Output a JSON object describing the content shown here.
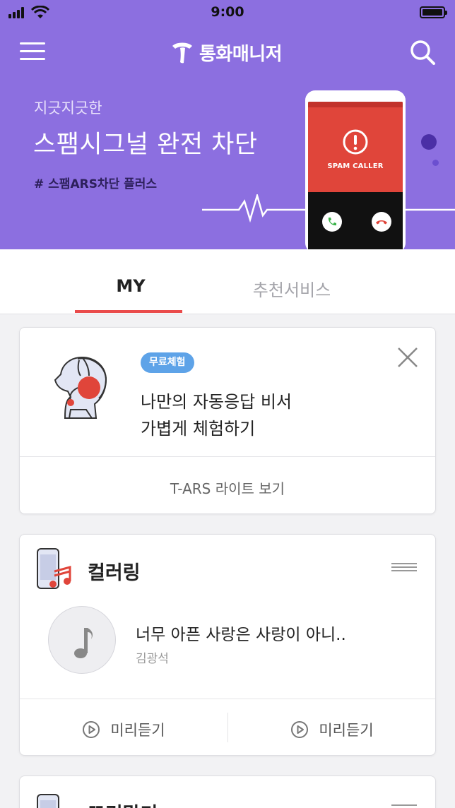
{
  "status_bar": {
    "time": "9:00"
  },
  "header": {
    "app_title": "통화매니저",
    "icons": {
      "menu": "hamburger-menu-icon",
      "search": "search-icon",
      "logo": "t-logo-icon"
    }
  },
  "banner": {
    "subtitle": "지긋지긋한",
    "headline": "스팸시그널 완전 차단",
    "tag": "# 스팸ARS차단 플러스",
    "phone_label": "SPAM CALLER"
  },
  "tabs": [
    {
      "label": "MY",
      "active": true
    },
    {
      "label": "추천서비스",
      "active": false
    }
  ],
  "promo_card": {
    "badge": "무료체험",
    "line1": "나만의 자동응답 비서",
    "line2": "가볍게 체험하기",
    "link": "T-ARS 라이트 보기"
  },
  "coloring_card": {
    "title": "컬러링",
    "song_title": "너무 아픈 사랑은 사랑이 아니..",
    "artist": "김광석",
    "preview_left": "미리듣기",
    "preview_right": "미리듣기"
  },
  "third_card": {
    "title": "꼬리말기"
  },
  "colors": {
    "banner_bg": "#8c6fe0",
    "tab_accent": "#ea4b4b",
    "badge_bg": "#5ea3e8",
    "phone_red": "#e0453a"
  }
}
